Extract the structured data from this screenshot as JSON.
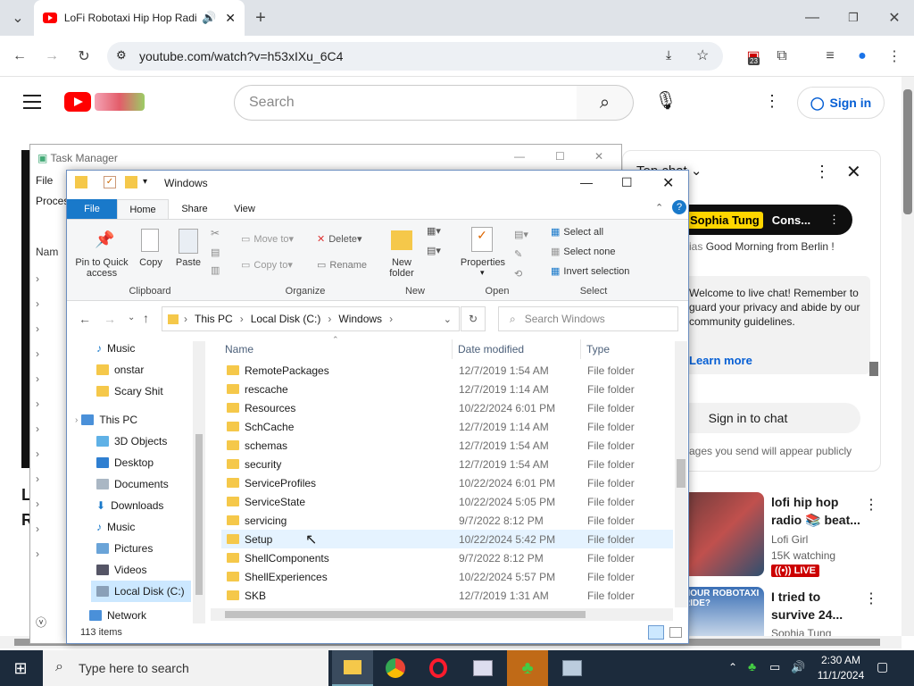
{
  "browser": {
    "tab_title": "LoFi Robotaxi Hip Hop Radio",
    "url": "youtube.com/watch?v=h53xIXu_6C4",
    "extension_badge": "23"
  },
  "youtube": {
    "search_placeholder": "Search",
    "sign_in": "Sign in",
    "chat": {
      "top_chat": "Top chat",
      "pinned_name": "Sophia Tung",
      "pinned_text": "Cons...",
      "message_user": "ias",
      "message_text": "Good Morning from Berlin !",
      "welcome": "Welcome to live chat! Remember to guard your privacy and abide by our community guidelines.",
      "learn_more": "Learn more",
      "sign_in_chat": "Sign in to chat",
      "public_note": "ages you send will appear publicly"
    },
    "related": [
      {
        "title": "lofi hip hop radio 📚 beat...",
        "channel": "Lofi Girl",
        "meta": "15K watching",
        "badge": "LIVE"
      },
      {
        "title": "I tried to survive 24...",
        "channel": "Sophia Tung",
        "thumb_text": "HOUR ROBOTAXI RIDE?"
      }
    ]
  },
  "task_manager": {
    "title": "Task Manager",
    "menu_file": "File",
    "tab": "Proces",
    "col_name": "Nam"
  },
  "explorer": {
    "title": "Windows",
    "ribbon_tabs": [
      "File",
      "Home",
      "Share",
      "View"
    ],
    "clipboard": {
      "pin": "Pin to Quick access",
      "copy": "Copy",
      "paste": "Paste",
      "label": "Clipboard"
    },
    "organize": {
      "move_to": "Move to",
      "copy_to": "Copy to",
      "delete": "Delete",
      "rename": "Rename",
      "label": "Organize"
    },
    "new": {
      "new_folder": "New folder",
      "label": "New"
    },
    "open": {
      "properties": "Properties",
      "label": "Open"
    },
    "select": {
      "select_all": "Select all",
      "select_none": "Select none",
      "invert": "Invert selection",
      "label": "Select"
    },
    "breadcrumb": [
      "This PC",
      "Local Disk (C:)",
      "Windows"
    ],
    "search_placeholder": "Search Windows",
    "columns": {
      "name": "Name",
      "date": "Date modified",
      "type": "Type"
    },
    "tree": [
      "Music",
      "onstar",
      "Scary Shit",
      "This PC",
      "3D Objects",
      "Desktop",
      "Documents",
      "Downloads",
      "Music",
      "Pictures",
      "Videos",
      "Local Disk (C:)",
      "Network"
    ],
    "files": [
      {
        "name": "RemotePackages",
        "date": "12/7/2019 1:54 AM",
        "type": "File folder"
      },
      {
        "name": "rescache",
        "date": "12/7/2019 1:14 AM",
        "type": "File folder"
      },
      {
        "name": "Resources",
        "date": "10/22/2024 6:01 PM",
        "type": "File folder"
      },
      {
        "name": "SchCache",
        "date": "12/7/2019 1:14 AM",
        "type": "File folder"
      },
      {
        "name": "schemas",
        "date": "12/7/2019 1:54 AM",
        "type": "File folder"
      },
      {
        "name": "security",
        "date": "12/7/2019 1:54 AM",
        "type": "File folder"
      },
      {
        "name": "ServiceProfiles",
        "date": "10/22/2024 6:01 PM",
        "type": "File folder"
      },
      {
        "name": "ServiceState",
        "date": "10/22/2024 5:05 PM",
        "type": "File folder"
      },
      {
        "name": "servicing",
        "date": "9/7/2022 8:12 PM",
        "type": "File folder"
      },
      {
        "name": "Setup",
        "date": "10/22/2024 5:42 PM",
        "type": "File folder"
      },
      {
        "name": "ShellComponents",
        "date": "9/7/2022 8:12 PM",
        "type": "File folder"
      },
      {
        "name": "ShellExperiences",
        "date": "10/22/2024 5:57 PM",
        "type": "File folder"
      },
      {
        "name": "SKB",
        "date": "12/7/2019 1:31 AM",
        "type": "File folder"
      }
    ],
    "status": "113 items"
  },
  "taskbar": {
    "search_placeholder": "Type here to search",
    "time": "2:30 AM",
    "date": "11/1/2024"
  }
}
